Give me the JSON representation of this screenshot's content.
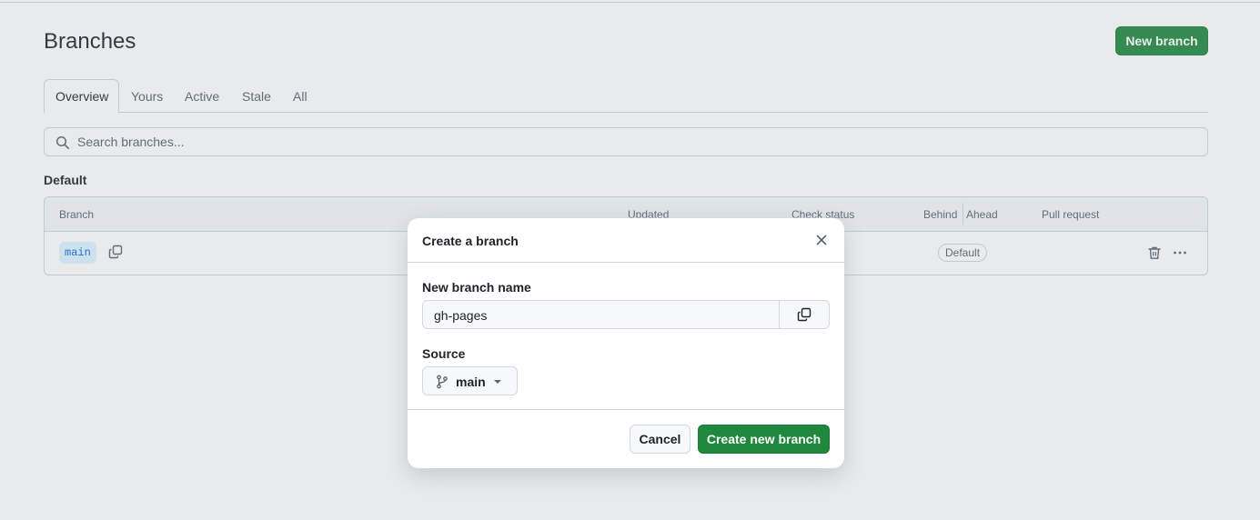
{
  "page": {
    "title": "Branches",
    "new_branch_label": "New branch"
  },
  "tabs": [
    {
      "label": "Overview",
      "active": true
    },
    {
      "label": "Yours",
      "active": false
    },
    {
      "label": "Active",
      "active": false
    },
    {
      "label": "Stale",
      "active": false
    },
    {
      "label": "All",
      "active": false
    }
  ],
  "search": {
    "placeholder": "Search branches...",
    "icon": "search-icon"
  },
  "section": {
    "label": "Default"
  },
  "table": {
    "columns": {
      "branch": "Branch",
      "updated": "Updated",
      "check_status": "Check status",
      "behind": "Behind",
      "ahead": "Ahead",
      "pull_request": "Pull request"
    },
    "rows": [
      {
        "branch": "main",
        "badge": "Default"
      }
    ]
  },
  "dialog": {
    "title": "Create a branch",
    "name_label": "New branch name",
    "name_value": "gh-pages",
    "source_label": "Source",
    "source_value": "main",
    "cancel_label": "Cancel",
    "create_label": "Create new branch"
  },
  "colors": {
    "primary_green": "#1f883d",
    "branch_pill_bg": "#ddf4ff",
    "branch_pill_text": "#0969da",
    "border": "#d0d7de"
  }
}
